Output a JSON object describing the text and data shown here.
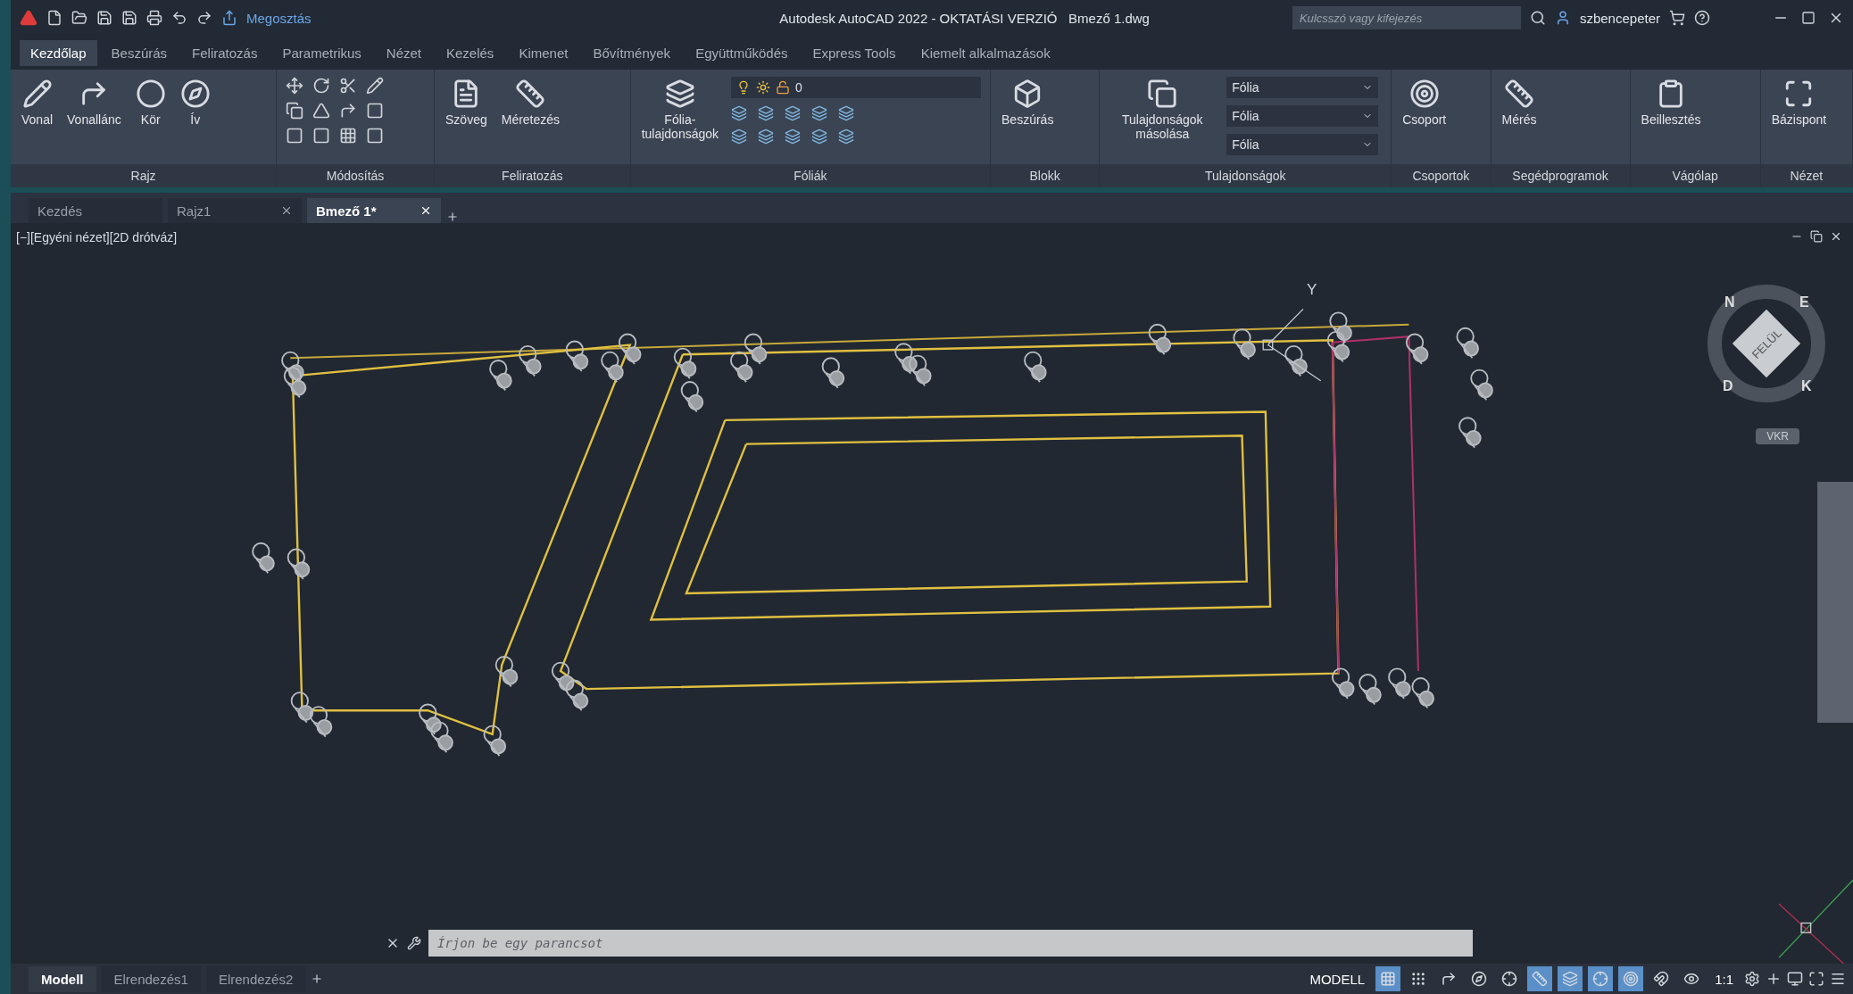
{
  "title_bar": {
    "share": "Megosztás",
    "title": "Autodesk AutoCAD 2022 - OKTATÁSI VERZIÓ",
    "file": "Bmező 1.dwg",
    "search": {
      "placeholder": "Kulcsszó vagy kifejezés"
    },
    "user": "szbencepeter"
  },
  "ribbon_tabs": [
    {
      "label": "Kezdőlap",
      "selected": true
    },
    {
      "label": "Beszúrás",
      "selected": false
    },
    {
      "label": "Feliratozás",
      "selected": false
    },
    {
      "label": "Parametrikus",
      "selected": false
    },
    {
      "label": "Nézet",
      "selected": false
    },
    {
      "label": "Kezelés",
      "selected": false
    },
    {
      "label": "Kimenet",
      "selected": false
    },
    {
      "label": "Bővítmények",
      "selected": false
    },
    {
      "label": "Együttműködés",
      "selected": false
    },
    {
      "label": "Express Tools",
      "selected": false
    },
    {
      "label": "Kiemelt alkalmazások",
      "selected": false
    }
  ],
  "ribbon_panels": [
    {
      "kind": "draw",
      "title": "Rajz",
      "tools": [
        "Vonal",
        "Vonallánc",
        "Kör",
        "Ív"
      ]
    },
    {
      "kind": "modify",
      "title": "Módosítás"
    },
    {
      "kind": "annotate",
      "title": "Feliratozás",
      "tools": [
        "Szöveg",
        "Méretezés"
      ]
    },
    {
      "kind": "layers",
      "title": "Fóliák",
      "tools": [
        "Fólia-tulajdonságok"
      ],
      "layer_value": "0"
    },
    {
      "kind": "block",
      "title": "Blokk",
      "tools": [
        "Beszúrás"
      ]
    },
    {
      "kind": "properties",
      "title": "Tulajdonságok",
      "tools": [
        "Tulajdonságok másolása"
      ],
      "dropdowns": [
        "Fólia",
        "Fólia",
        "Fólia"
      ]
    },
    {
      "kind": "groups",
      "title": "Csoportok",
      "tools": [
        "Csoport"
      ]
    },
    {
      "kind": "utilities",
      "title": "Segédprogramok",
      "tools": [
        "Mérés"
      ]
    },
    {
      "kind": "clipboard",
      "title": "Vágólap",
      "tools": [
        "Beillesztés"
      ]
    },
    {
      "kind": "view",
      "title": "Nézet",
      "tools": [
        "Bázispont"
      ]
    }
  ],
  "doc_tabs": [
    {
      "label": "Kezdés",
      "selected": false,
      "closable": false
    },
    {
      "label": "Rajz1",
      "selected": false,
      "closable": true
    },
    {
      "label": "Bmező 1*",
      "selected": true,
      "closable": true
    }
  ],
  "viewport": {
    "label": "[−][Egyéni nézet][2D drótváz]",
    "ucs_label": "Y",
    "viewcube": {
      "north": "N",
      "east": "E",
      "south": "D",
      "west": "K",
      "face": "FELÜL",
      "wcs": "VKR"
    }
  },
  "command_line": {
    "placeholder": "Írjon be egy parancsot"
  },
  "layout_tabs": [
    {
      "label": "Modell",
      "selected": true
    },
    {
      "label": "Elrendezés1",
      "selected": false
    },
    {
      "label": "Elrendezés2",
      "selected": false
    }
  ],
  "status_bar": {
    "space": "MODELL",
    "scale": "1:1",
    "toggles": [
      {
        "kind": "grid",
        "on": true
      },
      {
        "kind": "snap",
        "on": false
      },
      {
        "kind": "ortho",
        "on": false
      },
      {
        "kind": "polar",
        "on": false
      },
      {
        "kind": "osnap-track",
        "on": false
      },
      {
        "kind": "lineweight",
        "on": true
      },
      {
        "kind": "transparency",
        "on": true
      },
      {
        "kind": "dynamic-ucs",
        "on": true
      },
      {
        "kind": "annotation",
        "on": true
      },
      {
        "kind": "annoscale",
        "on": false
      },
      {
        "kind": "visibility",
        "on": false
      }
    ]
  }
}
